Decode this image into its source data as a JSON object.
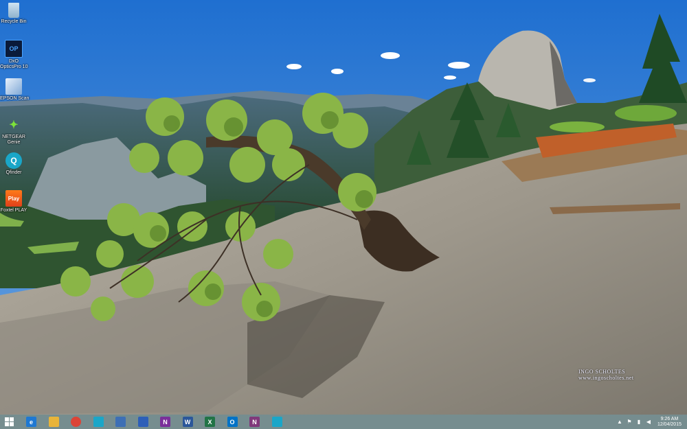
{
  "desktop": {
    "icons": [
      {
        "label": "Recycle Bin",
        "icon": "recycle-bin-icon"
      },
      {
        "label": "DxO OpticsPro 10",
        "label_line1": "DxO",
        "label_line2": "OpticsPro 10",
        "badge": "OP",
        "icon": "dxo-opticspro-icon"
      },
      {
        "label": "EPSON Scan",
        "icon": "epson-scan-icon"
      },
      {
        "label": "NETGEAR Genie",
        "label_line1": "NETGEAR",
        "label_line2": "Genie",
        "icon": "netgear-genie-icon"
      },
      {
        "label": "Qfinder",
        "icon": "qfinder-icon"
      },
      {
        "label": "Foxtel PLAY",
        "badge": "Play",
        "icon": "foxtel-play-icon"
      }
    ]
  },
  "watermark": {
    "line1": "INGO SCHOLTES",
    "line2": "www.ingoscholtes.net"
  },
  "taskbar": {
    "start": "start-icon",
    "pinned": [
      {
        "name": "internet-explorer-icon",
        "glyph": "e",
        "color": "#1e78d2"
      },
      {
        "name": "file-explorer-icon",
        "glyph": "",
        "color": "#e8b43a"
      },
      {
        "name": "chrome-icon",
        "glyph": "",
        "color": "#db4437"
      },
      {
        "name": "qfinder-icon",
        "glyph": "",
        "color": "#1aa6c8"
      },
      {
        "name": "network-icon",
        "glyph": "",
        "color": "#3d6fb5"
      },
      {
        "name": "app-icon",
        "glyph": "",
        "color": "#2d5fb8"
      },
      {
        "name": "onenote-icon",
        "glyph": "N",
        "color": "#7a2f9a"
      },
      {
        "name": "word-icon",
        "glyph": "W",
        "color": "#2b579a"
      },
      {
        "name": "excel-icon",
        "glyph": "X",
        "color": "#217346"
      },
      {
        "name": "outlook-icon",
        "glyph": "O",
        "color": "#0072c6"
      },
      {
        "name": "onenote-2-icon",
        "glyph": "N",
        "color": "#80397b"
      },
      {
        "name": "qfinder-2-icon",
        "glyph": "",
        "color": "#1aa6c8"
      }
    ],
    "tray": {
      "time": "9:26 AM",
      "date": "12/04/2015"
    }
  }
}
